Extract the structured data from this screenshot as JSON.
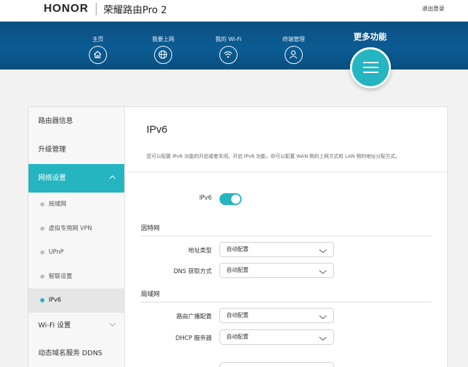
{
  "header": {
    "brand": "HONOR",
    "model": "荣耀路由Pro 2",
    "logout": "退出登录"
  },
  "nav": {
    "items": [
      {
        "label": "主页",
        "icon": "home-icon"
      },
      {
        "label": "我要上网",
        "icon": "globe-icon"
      },
      {
        "label": "我的 Wi-Fi",
        "icon": "wifi-icon"
      },
      {
        "label": "终端管理",
        "icon": "user-icon"
      }
    ],
    "more_label": "更多功能",
    "more_icon": "menu-icon"
  },
  "sidebar": {
    "items": [
      {
        "label": "路由器信息"
      },
      {
        "label": "升级管理"
      },
      {
        "label": "网络设置"
      }
    ],
    "sub_items": [
      {
        "label": "局域网"
      },
      {
        "label": "虚拟专用网 VPN"
      },
      {
        "label": "UPnP"
      },
      {
        "label": "智联设置"
      },
      {
        "label": "IPv6"
      }
    ],
    "after_items": [
      {
        "label": "Wi-Fi 设置"
      },
      {
        "label": "动态域名服务 DDNS"
      }
    ]
  },
  "content": {
    "title": "IPv6",
    "description": "您可以配置 IPv6 功能的开启或者关闭。开启 IPv6 功能，你可以配置 WAN 侧的上网方式和 LAN 侧的地址分配方式。",
    "ipv6_toggle_label": "IPv6",
    "ipv6_enabled": true,
    "internet_section": "因特网",
    "address_type_label": "地址类型",
    "address_type_value": "自动配置",
    "dns_label": "DNS 获取方式",
    "dns_value": "自动配置",
    "lan_section": "局域网",
    "router_adv_label": "路由广播配置",
    "router_adv_value": "自动配置",
    "dhcp_label": "DHCP 服务器",
    "dhcp_value": "自动配置"
  },
  "colors": {
    "accent": "#25b5c0",
    "nav_bg": "#0b5c93"
  }
}
